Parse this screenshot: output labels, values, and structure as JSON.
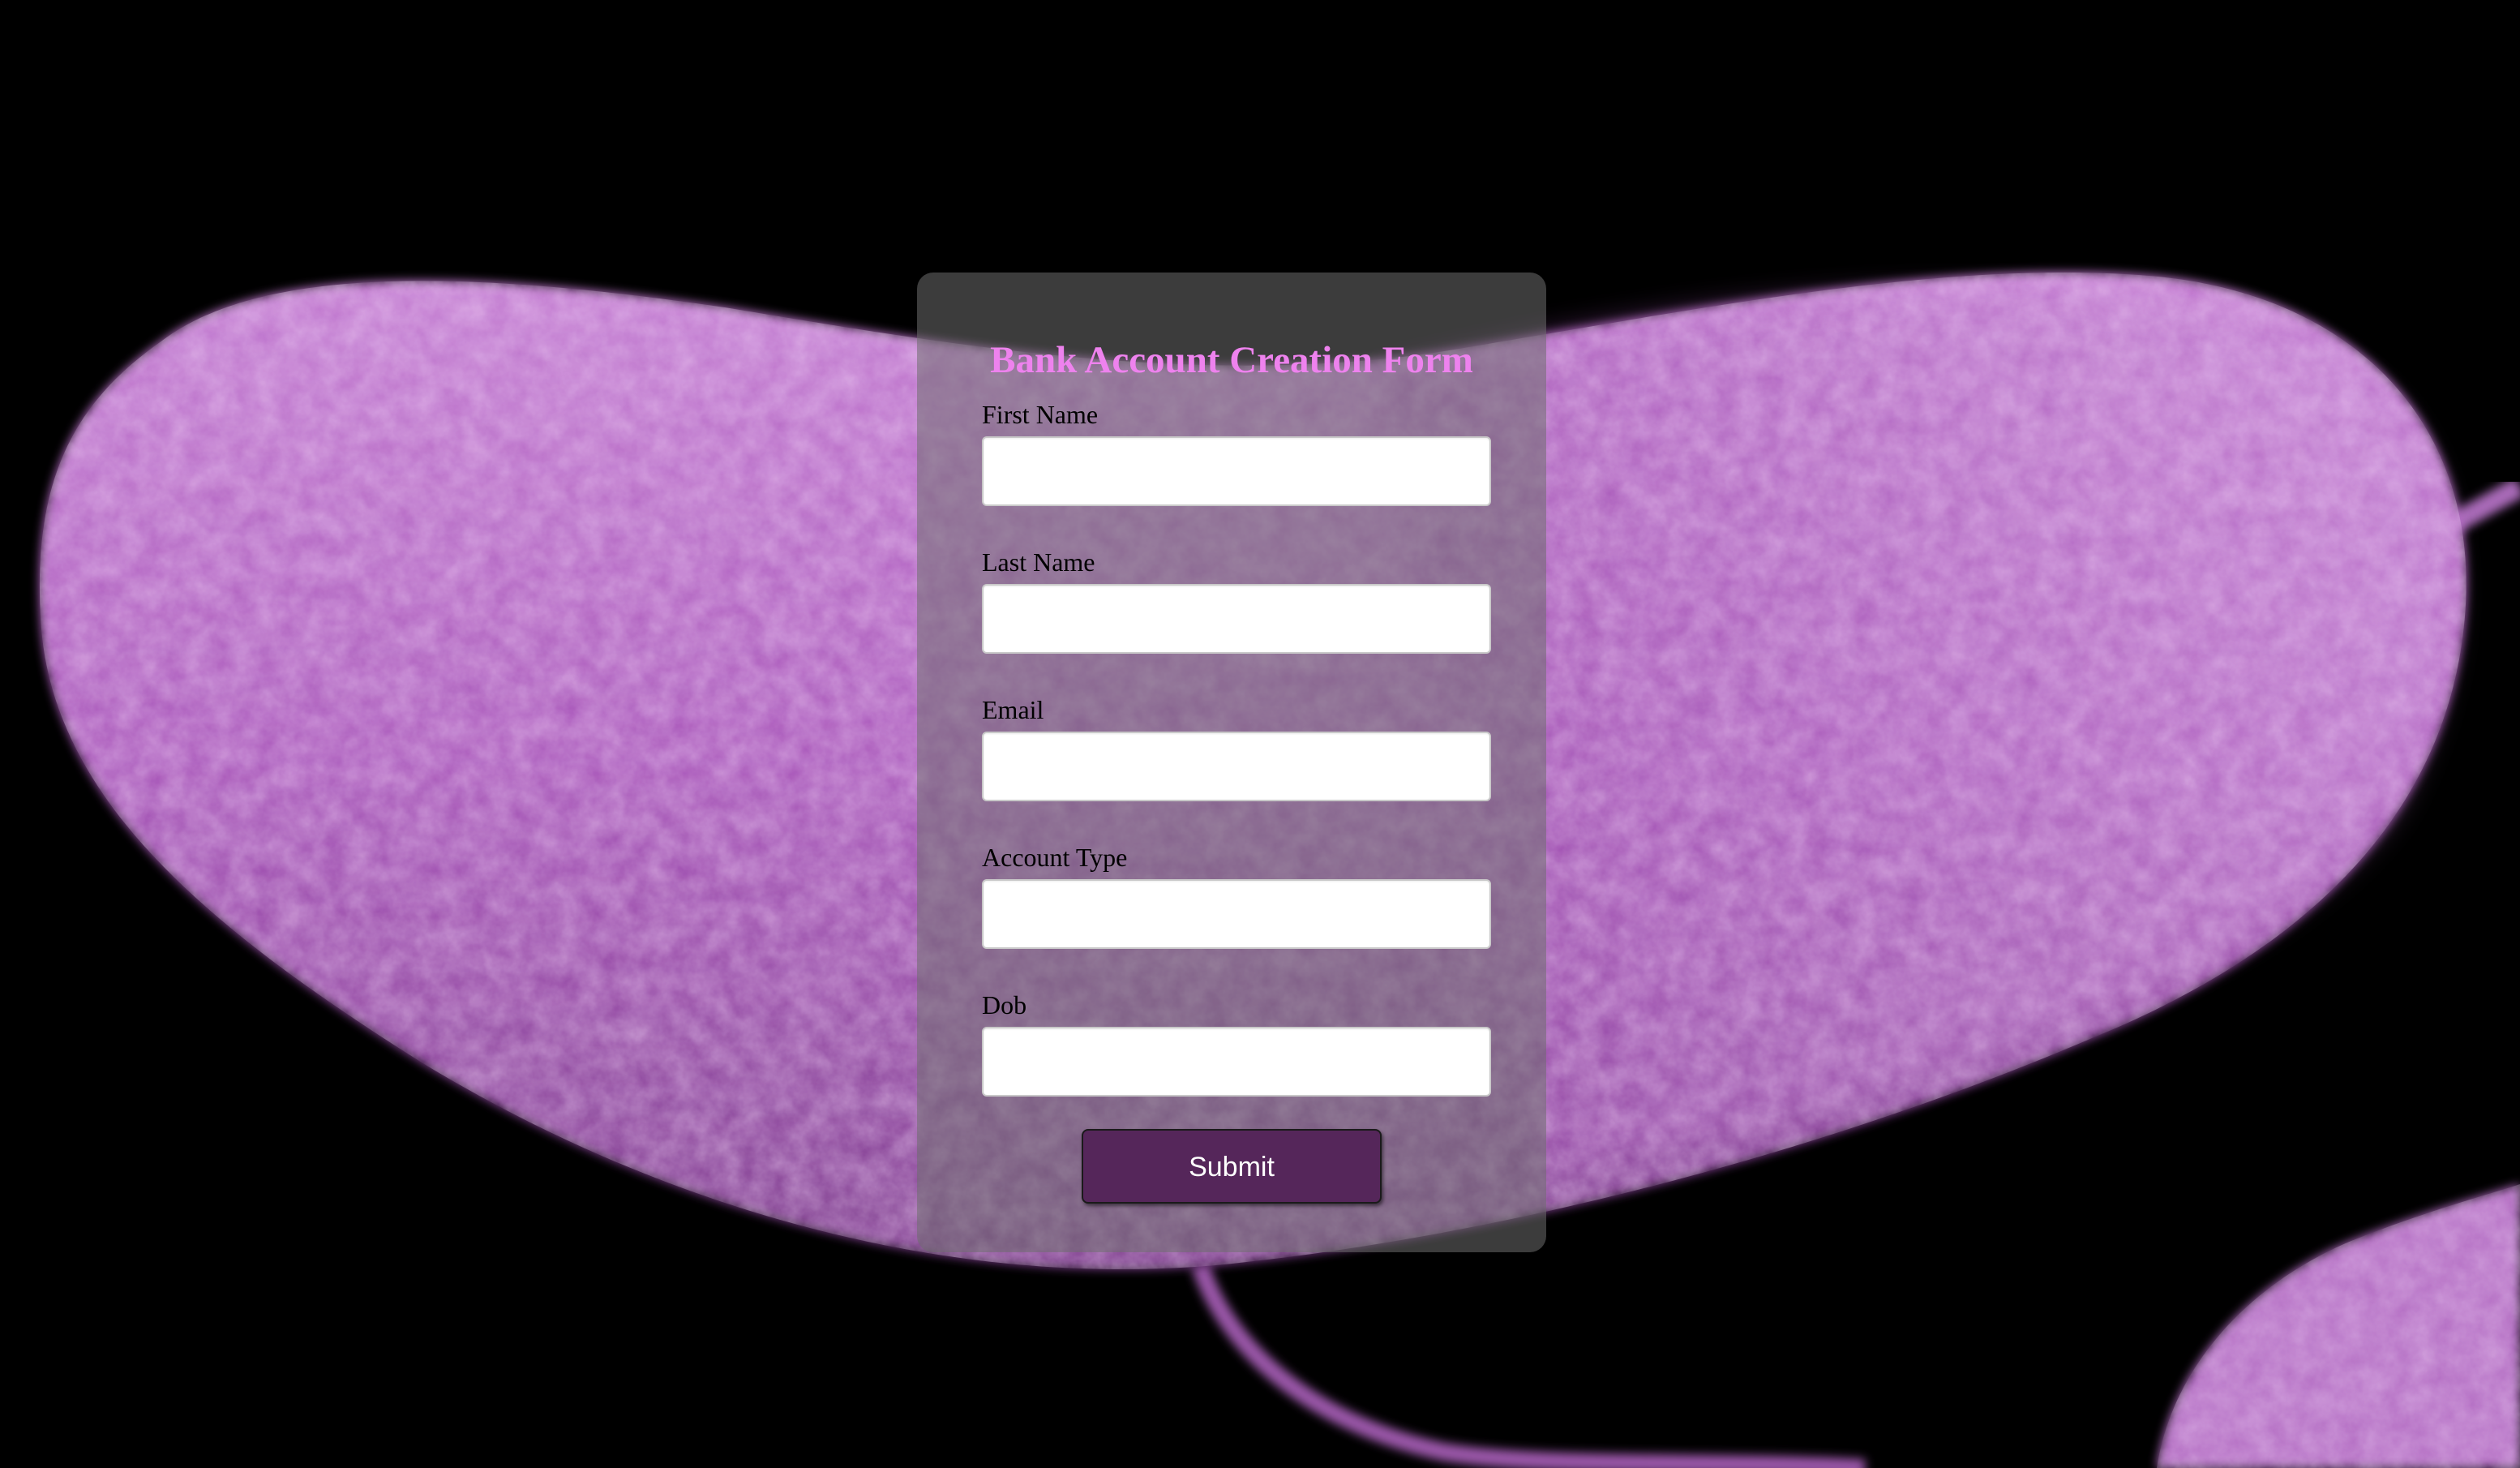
{
  "form": {
    "title": "Bank Account Creation Form",
    "fields": [
      {
        "label": "First Name",
        "value": ""
      },
      {
        "label": "Last Name",
        "value": ""
      },
      {
        "label": "Email",
        "value": ""
      },
      {
        "label": "Account Type",
        "value": ""
      },
      {
        "label": "Dob",
        "value": ""
      }
    ],
    "submit_label": "Submit"
  },
  "colors": {
    "title": "#ee82ee",
    "button": "#55265a",
    "background": "#000000",
    "bacterium": "#b46ac2"
  }
}
